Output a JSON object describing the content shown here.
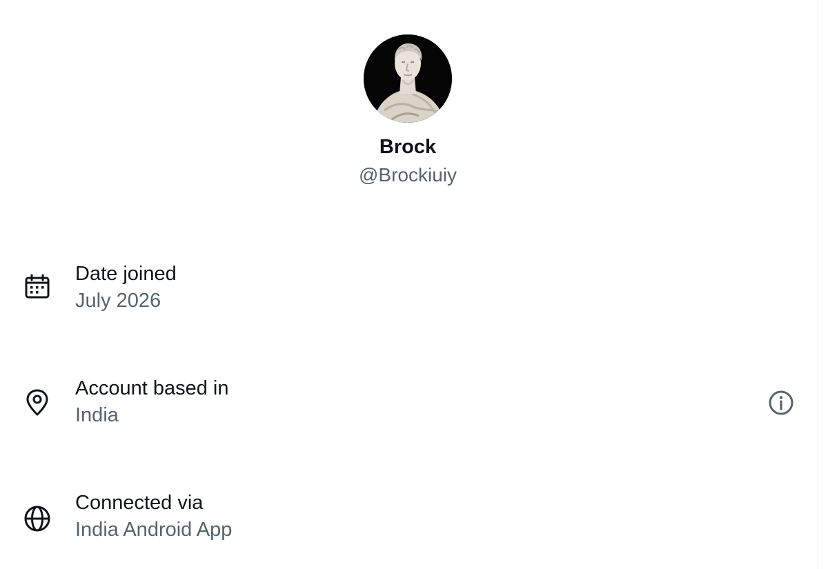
{
  "profile": {
    "display_name": "Brock",
    "handle": "@Brockiuiy"
  },
  "rows": [
    {
      "icon": "calendar-icon",
      "label": "Date joined",
      "value": "July 2026"
    },
    {
      "icon": "location-pin-icon",
      "label": "Account based in",
      "value": "India",
      "action_icon": "info-icon"
    },
    {
      "icon": "globe-icon",
      "label": "Connected via",
      "value": "India Android App"
    }
  ],
  "colors": {
    "primary_text": "#0f1419",
    "secondary_text": "#536471",
    "background": "#ffffff"
  }
}
